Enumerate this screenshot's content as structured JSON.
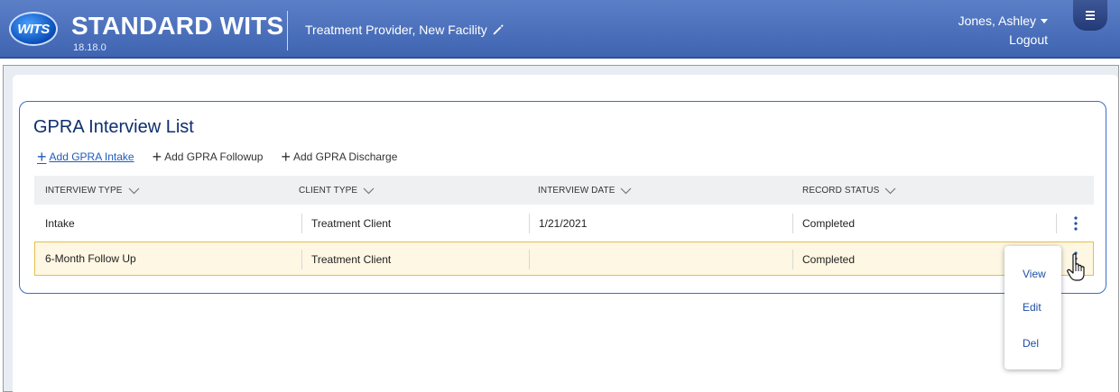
{
  "header": {
    "logo_text": "WITS",
    "title": "STANDARD WITS",
    "version": "18.18.0",
    "facility": "Treatment Provider, New Facility",
    "user": "Jones, Ashley",
    "logout": "Logout",
    "colors": {
      "header_bg": "#4a6fbd",
      "accent": "#1e5bbf"
    }
  },
  "card": {
    "title": "GPRA Interview List",
    "actions": [
      {
        "label": "Add GPRA Intake"
      },
      {
        "label": "Add GPRA Followup"
      },
      {
        "label": "Add GPRA Discharge"
      }
    ]
  },
  "table": {
    "columns": [
      "INTERVIEW TYPE",
      "CLIENT TYPE",
      "INTERVIEW DATE",
      "RECORD STATUS"
    ],
    "rows": [
      [
        "Intake",
        "Treatment Client",
        "1/21/2021",
        "Completed"
      ],
      [
        "6-Month Follow Up",
        "Treatment Client",
        "",
        "Completed"
      ]
    ]
  },
  "context_menu": {
    "items": [
      "View",
      "Edit",
      "Del"
    ]
  },
  "icons": {
    "edit": "pencil-icon",
    "menu": "hamburger-icon",
    "sort": "chevron-down-icon",
    "row_actions": "kebab-icon",
    "cursor": "hand-pointer-icon"
  }
}
